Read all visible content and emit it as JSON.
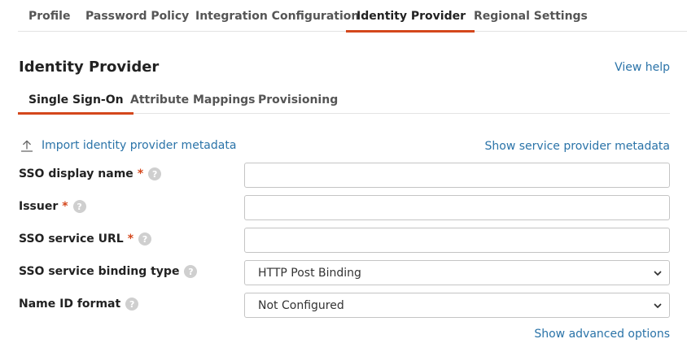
{
  "top_tabs": [
    {
      "label": "Profile",
      "active": false
    },
    {
      "label": "Password Policy",
      "active": false
    },
    {
      "label": "Integration Configuration",
      "active": false
    },
    {
      "label": "Identity Provider",
      "active": true
    },
    {
      "label": "Regional Settings",
      "active": false
    }
  ],
  "section": {
    "title": "Identity Provider",
    "help_link": "View help"
  },
  "sub_tabs": [
    {
      "label": "Single Sign-On",
      "active": true
    },
    {
      "label": "Attribute Mappings",
      "active": false
    },
    {
      "label": "Provisioning",
      "active": false
    }
  ],
  "metadata": {
    "import_link": "Import identity provider metadata",
    "show_sp_link": "Show service provider metadata"
  },
  "form": {
    "required_marker": "*",
    "help_glyph": "?",
    "sso_display_name": {
      "label": "SSO display name",
      "value": ""
    },
    "issuer": {
      "label": "Issuer",
      "value": ""
    },
    "sso_service_url": {
      "label": "SSO service URL",
      "value": ""
    },
    "binding_type": {
      "label": "SSO service binding type",
      "selected": "HTTP Post Binding"
    },
    "name_id_format": {
      "label": "Name ID format",
      "selected": "Not Configured"
    }
  },
  "advanced_link": "Show advanced options",
  "colors": {
    "accent": "#d4471c",
    "link": "#2a73a8"
  }
}
